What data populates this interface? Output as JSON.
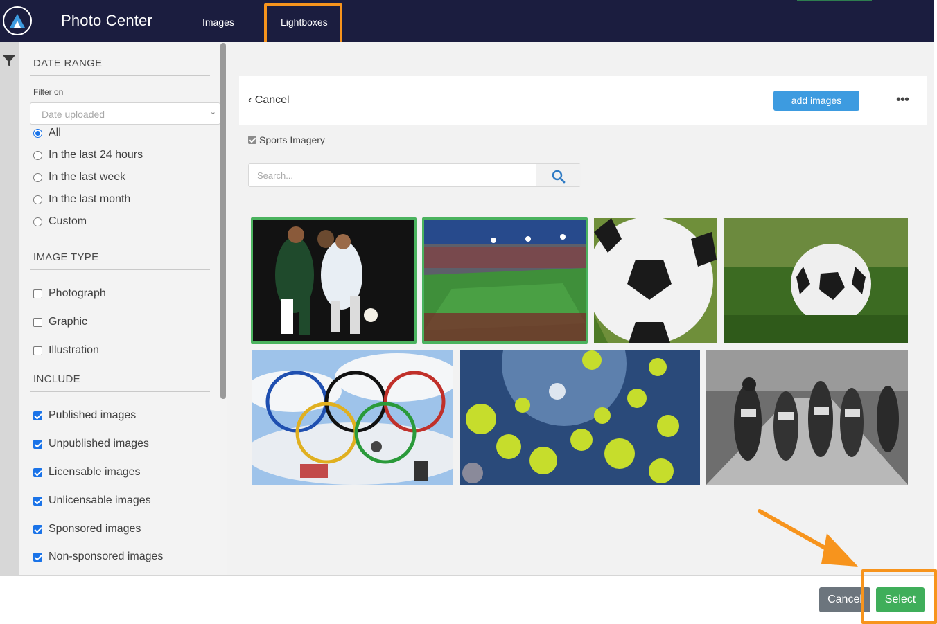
{
  "app": {
    "title": "Photo Center",
    "logo": "logo-icon"
  },
  "nav": {
    "items": [
      {
        "label": "Images"
      },
      {
        "label": "Lightboxes"
      }
    ],
    "highlight_color": "#f7941d"
  },
  "sidebar": {
    "date_range": {
      "title": "DATE RANGE",
      "filter_on_label": "Filter on",
      "select_placeholder": "Date uploaded",
      "options": [
        {
          "label": "All",
          "selected": true
        },
        {
          "label": "In the last 24 hours",
          "selected": false
        },
        {
          "label": "In the last week",
          "selected": false
        },
        {
          "label": "In the last month",
          "selected": false
        },
        {
          "label": "Custom",
          "selected": false
        }
      ]
    },
    "image_type": {
      "title": "IMAGE TYPE",
      "options": [
        {
          "label": "Photograph",
          "checked": false
        },
        {
          "label": "Graphic",
          "checked": false
        },
        {
          "label": "Illustration",
          "checked": false
        }
      ]
    },
    "include": {
      "title": "INCLUDE",
      "options": [
        {
          "label": "Published images",
          "checked": true
        },
        {
          "label": "Unpublished images",
          "checked": true
        },
        {
          "label": "Licensable images",
          "checked": true
        },
        {
          "label": "Unlicensable images",
          "checked": true
        },
        {
          "label": "Sponsored images",
          "checked": true
        },
        {
          "label": "Non-sponsored images",
          "checked": true
        }
      ]
    }
  },
  "toolbar": {
    "cancel_label": "Cancel",
    "add_images_label": "add images",
    "more_label": "•••"
  },
  "lightbox": {
    "name": "Sports Imagery",
    "checked": true
  },
  "search": {
    "placeholder": "Search..."
  },
  "gallery": {
    "images": [
      {
        "subject": "soccer players",
        "selected": true
      },
      {
        "subject": "soccer stadium",
        "selected": true
      },
      {
        "subject": "soccer ball close-up",
        "selected": false
      },
      {
        "subject": "soccer ball on grass",
        "selected": false
      },
      {
        "subject": "olympic rings collage",
        "selected": false
      },
      {
        "subject": "tennis balls",
        "selected": false
      },
      {
        "subject": "sprinters",
        "selected": false
      }
    ]
  },
  "footer": {
    "cancel_label": "Cancel",
    "select_label": "Select"
  },
  "colors": {
    "nav_bg": "#1b1d3f",
    "accent": "#3d9be0",
    "select_green": "#3fae5a",
    "annotation": "#f7941d"
  }
}
